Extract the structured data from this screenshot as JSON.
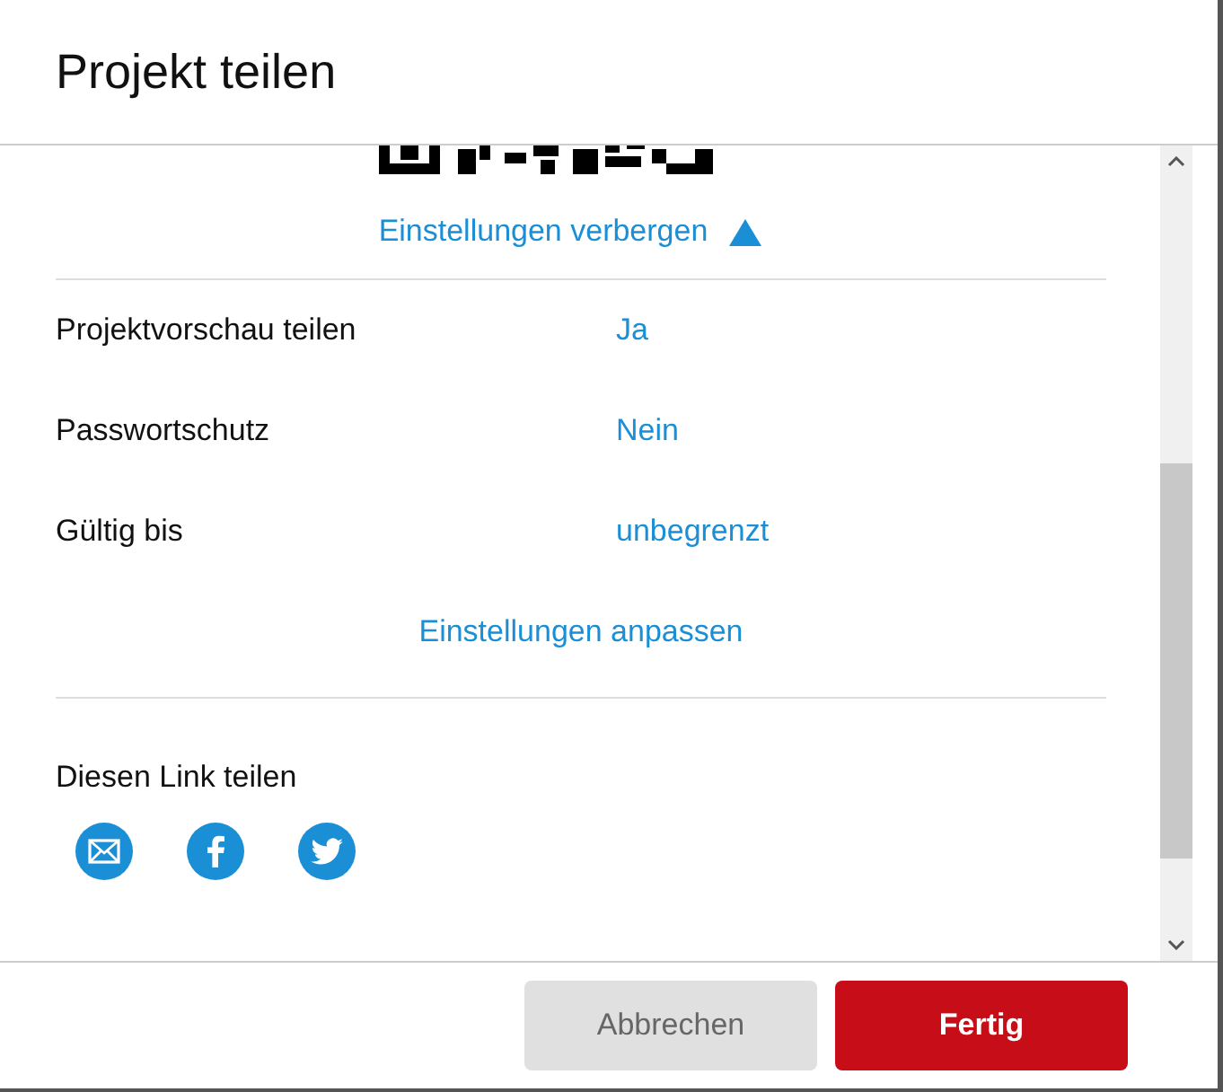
{
  "dialog": {
    "title": "Projekt teilen"
  },
  "toggle_link": {
    "label": "Einstellungen verbergen",
    "expanded": true
  },
  "settings": [
    {
      "label": "Projektvorschau teilen",
      "value": "Ja"
    },
    {
      "label": "Passwortschutz",
      "value": "Nein"
    },
    {
      "label": "Gültig bis",
      "value": "unbegrenzt"
    }
  ],
  "adjust_link": "Einstellungen anpassen",
  "share": {
    "heading": "Diesen Link teilen",
    "icons": [
      {
        "kind": "mail"
      },
      {
        "kind": "facebook"
      },
      {
        "kind": "twitter"
      }
    ]
  },
  "buttons": [
    {
      "label": "Abbrechen",
      "kind": "secondary"
    },
    {
      "label": "Fertig",
      "kind": "primary"
    }
  ]
}
